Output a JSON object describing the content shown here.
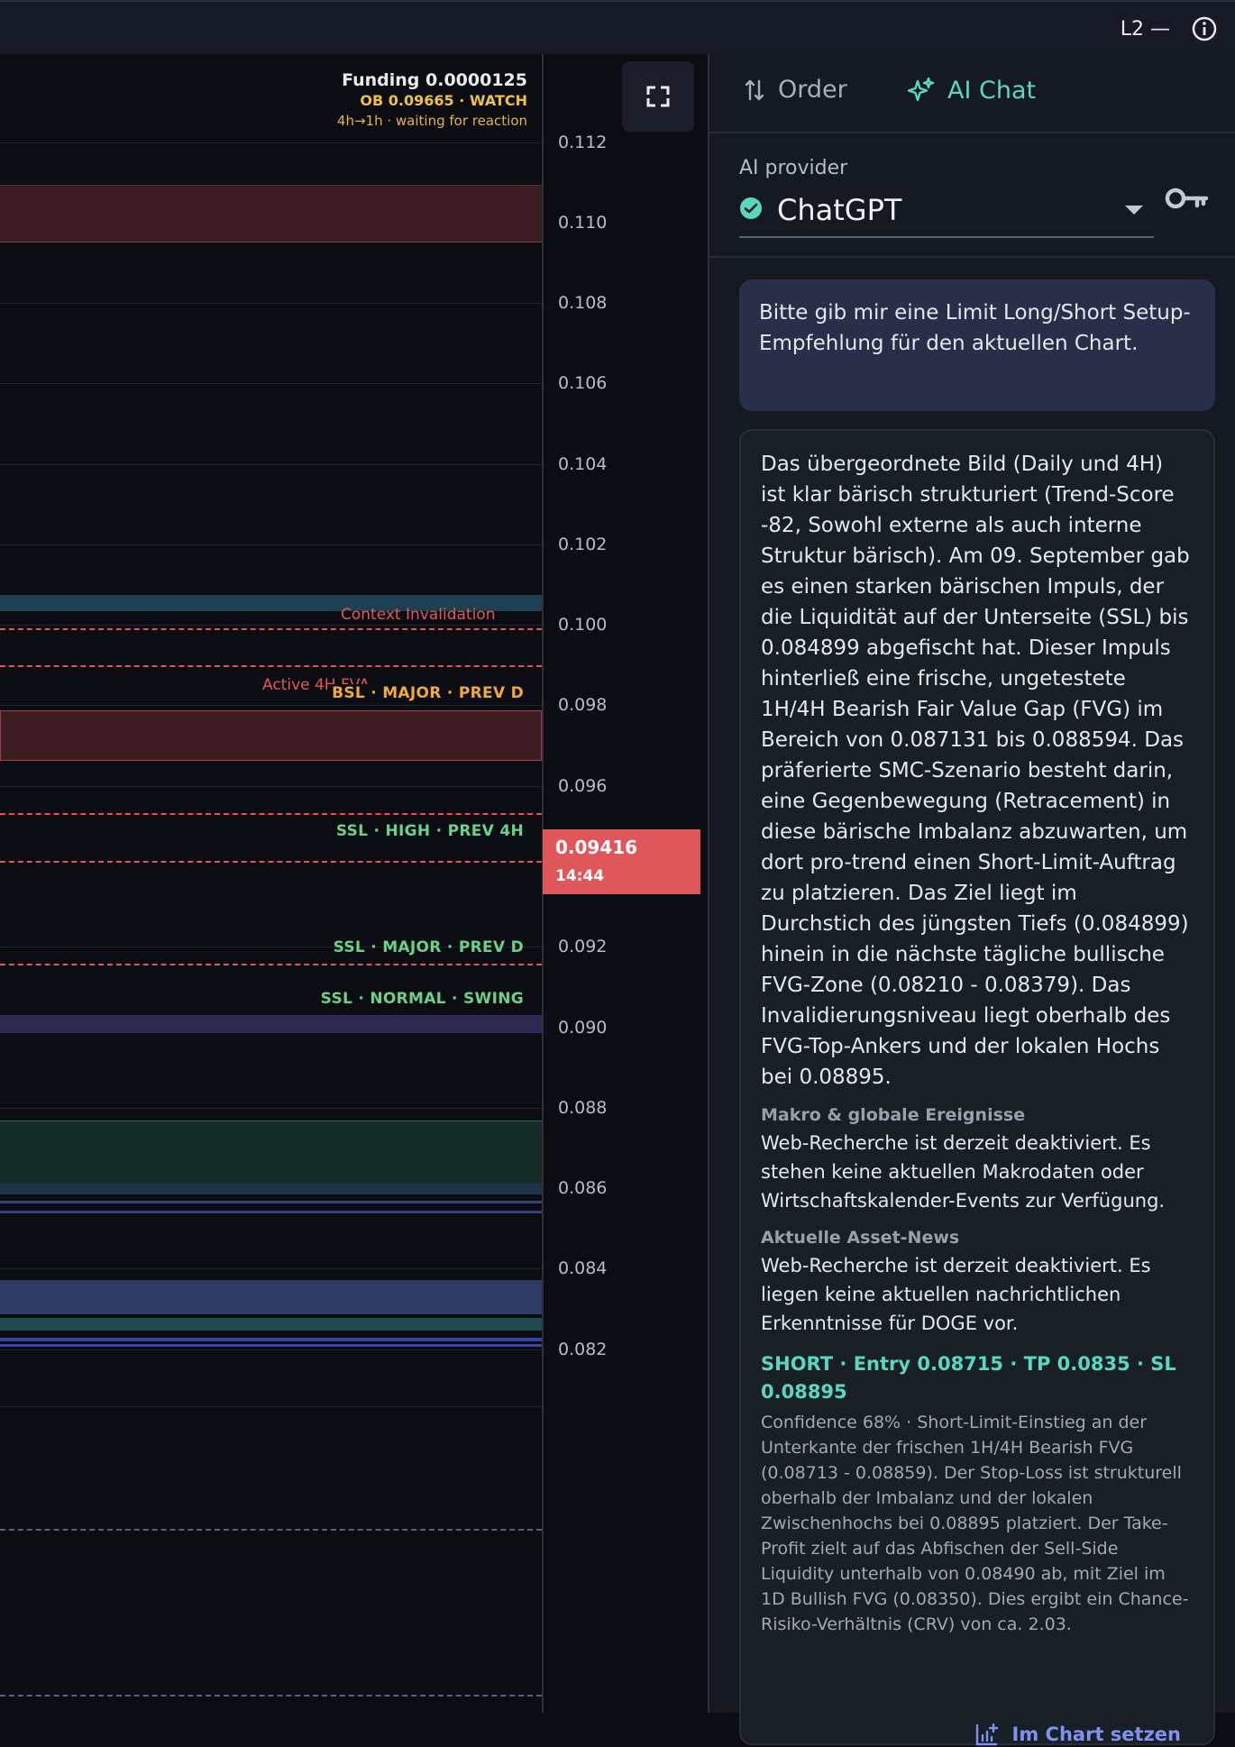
{
  "topbar": {
    "l2_label": "L2 —"
  },
  "chart": {
    "funding": "Funding 0.0000125",
    "ob": "OB 0.09665 · WATCH",
    "timeframe": "4h→1h · waiting for reaction",
    "axis_ticks": [
      "0.112",
      "0.110",
      "0.108",
      "0.106",
      "0.104",
      "0.102",
      "0.100",
      "0.098",
      "0.096",
      "0.092",
      "0.090",
      "0.088",
      "0.086",
      "0.084",
      "0.082"
    ],
    "context_label": "Context Invalidation",
    "active_label": "Active 4H FVA",
    "levels": {
      "bsl": "BSL · MAJOR · PREV D",
      "ssl_high": "SSL · HIGH · PREV 4H",
      "ssl_major": "SSL · MAJOR · PREV D",
      "ssl_normal": "SSL · NORMAL · SWING"
    },
    "price": {
      "value": "0.09416",
      "countdown": "14:44"
    }
  },
  "panel": {
    "tabs": {
      "order": "Order",
      "ai": "AI Chat"
    },
    "provider_label": "AI provider",
    "provider_value": "ChatGPT",
    "user_message": "Bitte gib mir eine Limit Long/Short Setup-Empfehlung für den aktuellen Chart.",
    "ai_main": "Das übergeordnete Bild (Daily und 4H) ist klar bärisch strukturiert (Trend-Score -82, Sowohl externe als auch interne Struktur bärisch). Am 09. September gab es einen starken bärischen Impuls, der die Liquidität auf der Unterseite (SSL) bis 0.084899 abgefischt hat. Dieser Impuls hinterließ eine frische, ungetestete 1H/4H Bearish Fair Value Gap (FVG) im Bereich von 0.087131 bis 0.088594. Das präferierte SMC-Szenario besteht darin, eine Gegenbewegung (Retracement) in diese bärische Imbalanz abzuwarten, um dort pro-trend einen Short-Limit-Auftrag zu platzieren. Das Ziel liegt im Durchstich des jüngsten Tiefs (0.084899) hinein in die nächste tägliche bullische FVG-Zone (0.08210 - 0.08379). Das Invalidierungsniveau liegt oberhalb des FVG-Top-Ankers und der lokalen Hochs bei 0.08895.",
    "macro_title": "Makro & globale Ereignisse",
    "macro_text": "Web-Recherche ist derzeit deaktiviert. Es stehen keine aktuellen Makrodaten oder Wirtschaftskalender-Events zur Verfügung.",
    "news_title": "Aktuelle Asset-News",
    "news_text": "Web-Recherche ist derzeit deaktiviert. Es liegen keine aktuellen nachrichtlichen Erkenntnisse für DOGE vor.",
    "signal": "SHORT · Entry 0.08715 · TP 0.0835 · SL 0.08895",
    "confidence": "Confidence 68% · Short-Limit-Einstieg an der Unterkante der frischen 1H/4H Bearish FVG (0.08713 - 0.08859). Der Stop-Loss ist strukturell oberhalb der Imbalanz und der lokalen Zwischenhochs bei 0.08895 platziert. Der Take-Profit zielt auf das Abfischen der Sell-Side Liquidity unterhalb von 0.08490 ab, mit Ziel im 1D Bullish FVG (0.08350). Dies ergibt ein Chance-Risiko-Verhältnis (CRV) von ca. 2.03.",
    "chart_button": "Im Chart setzen"
  }
}
